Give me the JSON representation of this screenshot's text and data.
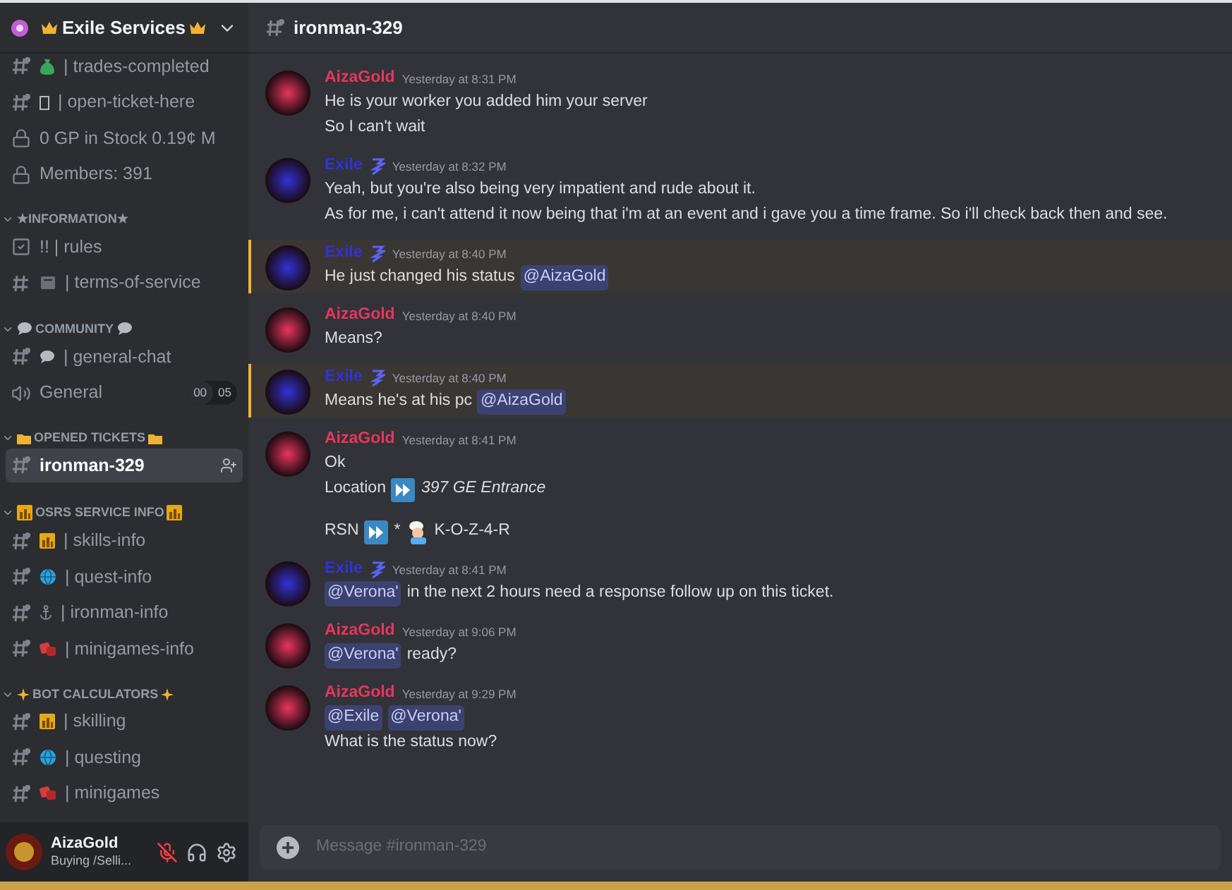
{
  "server": {
    "name": "Exile Services",
    "emblem": {
      "kind": "crown"
    }
  },
  "sidebar": {
    "items": [
      {
        "kind": "text",
        "emblem": {
          "kind": "bag"
        },
        "name": "| trades-completed",
        "selected": false
      },
      {
        "kind": "text",
        "emblem": {
          "kind": "box"
        },
        "name": "| open-ticket-here",
        "selected": false
      },
      {
        "kind": "locked",
        "name": "0 GP in Stock 0.19¢ M",
        "selected": false
      },
      {
        "kind": "locked",
        "name": "Members: 391",
        "selected": false
      },
      {
        "kind": "category",
        "name": "★INFORMATION★"
      },
      {
        "kind": "rules",
        "name": "!! | rules",
        "selected": false
      },
      {
        "kind": "plain",
        "emblem": {
          "kind": "memo"
        },
        "name": "| terms-of-service",
        "selected": false
      },
      {
        "kind": "category",
        "emblem": {
          "kind": "speech"
        },
        "name": "COMMUNITY"
      },
      {
        "kind": "text",
        "emblem": {
          "kind": "speech"
        },
        "name": "| general-chat",
        "selected": false
      },
      {
        "kind": "voice",
        "name": "General",
        "counts": [
          "00",
          "05"
        ],
        "selected": false
      },
      {
        "kind": "category",
        "emblem": {
          "kind": "folder"
        },
        "name": "OPENED TICKETS"
      },
      {
        "kind": "text",
        "name": "ironman-329",
        "selected": true
      },
      {
        "kind": "category",
        "emblem": {
          "kind": "chart"
        },
        "name": "OSRS SERVICE INFO"
      },
      {
        "kind": "text",
        "emblem": {
          "kind": "chart"
        },
        "name": "| skills-info",
        "selected": false
      },
      {
        "kind": "text",
        "emblem": {
          "kind": "globe"
        },
        "name": "| quest-info",
        "selected": false
      },
      {
        "kind": "text",
        "emblem": {
          "kind": "anchor"
        },
        "name": "| ironman-info",
        "selected": false
      },
      {
        "kind": "text",
        "emblem": {
          "kind": "dice"
        },
        "name": "| minigames-info",
        "selected": false
      },
      {
        "kind": "category",
        "emblem": {
          "kind": "sparkle"
        },
        "name": "BOT CALCULATORS"
      },
      {
        "kind": "text",
        "emblem": {
          "kind": "chart"
        },
        "name": "| skilling",
        "selected": false
      },
      {
        "kind": "text",
        "emblem": {
          "kind": "globe"
        },
        "name": "| questing",
        "selected": false
      },
      {
        "kind": "text",
        "emblem": {
          "kind": "dice"
        },
        "name": "| minigames",
        "selected": false
      }
    ]
  },
  "user_panel": {
    "name": "AizaGold",
    "status": "Buying /Selli...",
    "muted": true
  },
  "channel_header": {
    "title": "ironman-329"
  },
  "messages": [
    {
      "author": "AizaGold",
      "color": "#e8365d",
      "bot_badge": false,
      "time": "Yesterday at 8:31 PM",
      "highlighted": false,
      "lines": [
        {
          "segments": [
            {
              "kind": "text",
              "text": "He is your worker you added him your server"
            }
          ]
        },
        {
          "segments": [
            {
              "kind": "text",
              "text": "So I can't wait"
            }
          ]
        }
      ]
    },
    {
      "author": "Exile",
      "color": "#3232d8",
      "bot_badge": true,
      "time": "Yesterday at 8:32 PM",
      "highlighted": false,
      "lines": [
        {
          "segments": [
            {
              "kind": "text",
              "text": "Yeah, but you're also being very impatient and rude about it."
            }
          ]
        },
        {
          "segments": [
            {
              "kind": "text",
              "text": "As for me, i can't attend it now being that i'm at an event and i gave you a time frame. So i'll check back then and see."
            }
          ]
        }
      ]
    },
    {
      "author": "Exile",
      "color": "#3232d8",
      "bot_badge": true,
      "time": "Yesterday at 8:40 PM",
      "highlighted": true,
      "lines": [
        {
          "segments": [
            {
              "kind": "text",
              "text": "He just changed his status"
            },
            {
              "kind": "mention",
              "text": "@AizaGold"
            }
          ]
        }
      ]
    },
    {
      "author": "AizaGold",
      "color": "#e8365d",
      "bot_badge": false,
      "time": "Yesterday at 8:40 PM",
      "highlighted": false,
      "lines": [
        {
          "segments": [
            {
              "kind": "text",
              "text": "Means?"
            }
          ]
        }
      ]
    },
    {
      "author": "Exile",
      "color": "#3232d8",
      "bot_badge": true,
      "time": "Yesterday at 8:40 PM",
      "highlighted": true,
      "lines": [
        {
          "segments": [
            {
              "kind": "text",
              "text": "Means he's at his pc"
            },
            {
              "kind": "mention",
              "text": "@AizaGold"
            }
          ]
        }
      ]
    },
    {
      "author": "AizaGold",
      "color": "#e8365d",
      "bot_badge": false,
      "time": "Yesterday at 8:41 PM",
      "highlighted": false,
      "lines": [
        {
          "segments": [
            {
              "kind": "text",
              "text": "Ok"
            }
          ]
        },
        {
          "segments": [
            {
              "kind": "text",
              "text": "Location"
            },
            {
              "kind": "forward"
            },
            {
              "kind": "italic",
              "text": "397 GE  Entrance"
            }
          ]
        }
      ],
      "after_blank_line": [
        {
          "segments": [
            {
              "kind": "text",
              "text": "RSN"
            },
            {
              "kind": "forward"
            },
            {
              "kind": "text",
              "text": "*"
            },
            {
              "kind": "chef"
            },
            {
              "kind": "text",
              "text": "K-O-Z-4-R"
            }
          ]
        }
      ]
    },
    {
      "author": "Exile",
      "color": "#3232d8",
      "bot_badge": true,
      "time": "Yesterday at 8:41 PM",
      "highlighted": false,
      "lines": [
        {
          "segments": [
            {
              "kind": "mention",
              "text": "@Verona'"
            },
            {
              "kind": "text",
              "text": "in the next 2 hours need a response follow up on this ticket."
            }
          ]
        }
      ]
    },
    {
      "author": "AizaGold",
      "color": "#e8365d",
      "bot_badge": false,
      "time": "Yesterday at 9:06 PM",
      "highlighted": false,
      "lines": [
        {
          "segments": [
            {
              "kind": "mention",
              "text": "@Verona'"
            },
            {
              "kind": "text",
              "text": "ready?"
            }
          ]
        }
      ]
    },
    {
      "author": "AizaGold",
      "color": "#e8365d",
      "bot_badge": false,
      "time": "Yesterday at 9:29 PM",
      "highlighted": false,
      "lines": [
        {
          "segments": [
            {
              "kind": "mention",
              "text": "@Exile"
            },
            {
              "kind": "mention",
              "text": "@Verona'"
            }
          ]
        },
        {
          "segments": [
            {
              "kind": "text",
              "text": "What is the status now?"
            }
          ]
        }
      ]
    }
  ],
  "composer": {
    "placeholder": "Message #ironman-329"
  }
}
